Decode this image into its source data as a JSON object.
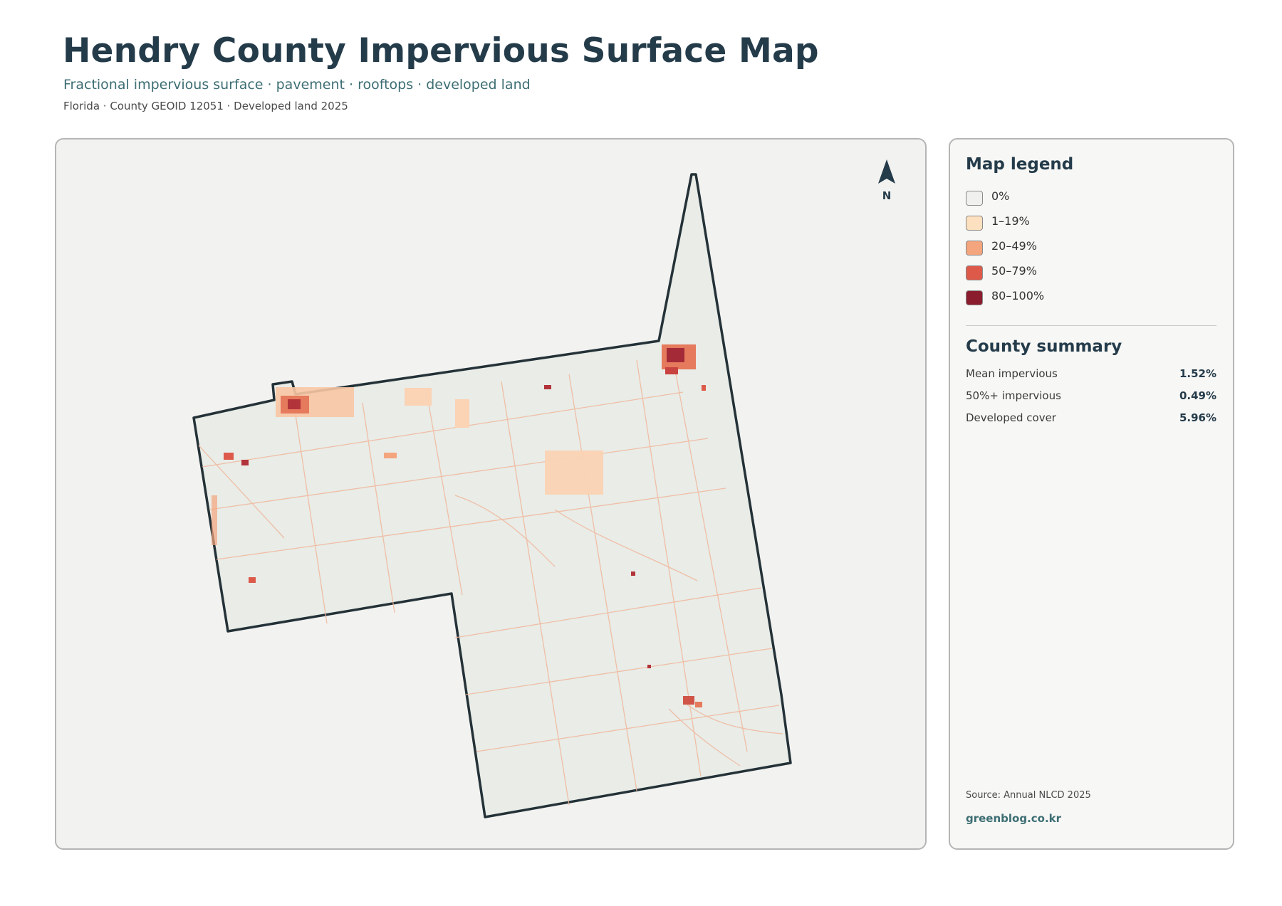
{
  "header": {
    "title": "Hendry County Impervious Surface Map",
    "subtitle": "Fractional impervious surface · pavement · rooftops · developed land",
    "meta": "Florida · County GEOID 12051 · Developed land 2025"
  },
  "map": {
    "north_label": "N",
    "fill_color": "#e9ece7",
    "outline_color": "#243238"
  },
  "legend": {
    "title": "Map legend",
    "items": [
      {
        "label": "0%",
        "color": "#f0f0ee"
      },
      {
        "label": "1–19%",
        "color": "#fde0bf"
      },
      {
        "label": "20–49%",
        "color": "#f4a57d"
      },
      {
        "label": "50–79%",
        "color": "#dd5a4a"
      },
      {
        "label": "80–100%",
        "color": "#8b1c2e"
      }
    ]
  },
  "summary": {
    "title": "County summary",
    "rows": [
      {
        "label": "Mean impervious",
        "value": "1.52%"
      },
      {
        "label": "50%+ impervious",
        "value": "0.49%"
      },
      {
        "label": "Developed cover",
        "value": "5.96%"
      }
    ]
  },
  "footer": {
    "source": "Source: Annual NLCD 2025",
    "brand": "greenblog.co.kr"
  }
}
